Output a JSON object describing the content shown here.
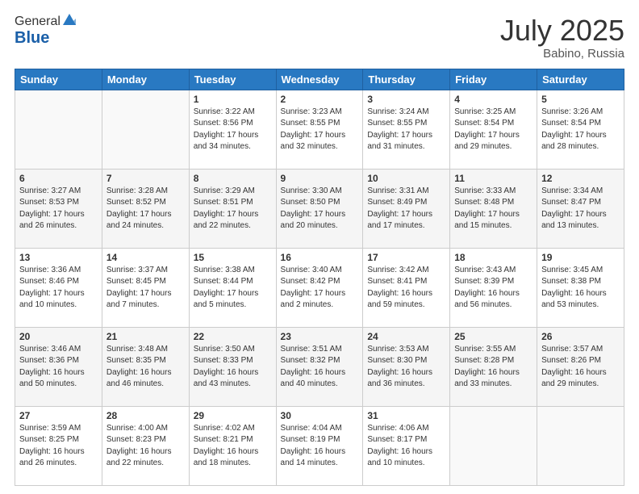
{
  "header": {
    "logo_general": "General",
    "logo_blue": "Blue",
    "month_year": "July 2025",
    "location": "Babino, Russia"
  },
  "calendar": {
    "days_of_week": [
      "Sunday",
      "Monday",
      "Tuesday",
      "Wednesday",
      "Thursday",
      "Friday",
      "Saturday"
    ],
    "weeks": [
      [
        {
          "day": "",
          "info": ""
        },
        {
          "day": "",
          "info": ""
        },
        {
          "day": "1",
          "sunrise": "3:22 AM",
          "sunset": "8:56 PM",
          "daylight": "17 hours and 34 minutes."
        },
        {
          "day": "2",
          "sunrise": "3:23 AM",
          "sunset": "8:55 PM",
          "daylight": "17 hours and 32 minutes."
        },
        {
          "day": "3",
          "sunrise": "3:24 AM",
          "sunset": "8:55 PM",
          "daylight": "17 hours and 31 minutes."
        },
        {
          "day": "4",
          "sunrise": "3:25 AM",
          "sunset": "8:54 PM",
          "daylight": "17 hours and 29 minutes."
        },
        {
          "day": "5",
          "sunrise": "3:26 AM",
          "sunset": "8:54 PM",
          "daylight": "17 hours and 28 minutes."
        }
      ],
      [
        {
          "day": "6",
          "sunrise": "3:27 AM",
          "sunset": "8:53 PM",
          "daylight": "17 hours and 26 minutes."
        },
        {
          "day": "7",
          "sunrise": "3:28 AM",
          "sunset": "8:52 PM",
          "daylight": "17 hours and 24 minutes."
        },
        {
          "day": "8",
          "sunrise": "3:29 AM",
          "sunset": "8:51 PM",
          "daylight": "17 hours and 22 minutes."
        },
        {
          "day": "9",
          "sunrise": "3:30 AM",
          "sunset": "8:50 PM",
          "daylight": "17 hours and 20 minutes."
        },
        {
          "day": "10",
          "sunrise": "3:31 AM",
          "sunset": "8:49 PM",
          "daylight": "17 hours and 17 minutes."
        },
        {
          "day": "11",
          "sunrise": "3:33 AM",
          "sunset": "8:48 PM",
          "daylight": "17 hours and 15 minutes."
        },
        {
          "day": "12",
          "sunrise": "3:34 AM",
          "sunset": "8:47 PM",
          "daylight": "17 hours and 13 minutes."
        }
      ],
      [
        {
          "day": "13",
          "sunrise": "3:36 AM",
          "sunset": "8:46 PM",
          "daylight": "17 hours and 10 minutes."
        },
        {
          "day": "14",
          "sunrise": "3:37 AM",
          "sunset": "8:45 PM",
          "daylight": "17 hours and 7 minutes."
        },
        {
          "day": "15",
          "sunrise": "3:38 AM",
          "sunset": "8:44 PM",
          "daylight": "17 hours and 5 minutes."
        },
        {
          "day": "16",
          "sunrise": "3:40 AM",
          "sunset": "8:42 PM",
          "daylight": "17 hours and 2 minutes."
        },
        {
          "day": "17",
          "sunrise": "3:42 AM",
          "sunset": "8:41 PM",
          "daylight": "16 hours and 59 minutes."
        },
        {
          "day": "18",
          "sunrise": "3:43 AM",
          "sunset": "8:39 PM",
          "daylight": "16 hours and 56 minutes."
        },
        {
          "day": "19",
          "sunrise": "3:45 AM",
          "sunset": "8:38 PM",
          "daylight": "16 hours and 53 minutes."
        }
      ],
      [
        {
          "day": "20",
          "sunrise": "3:46 AM",
          "sunset": "8:36 PM",
          "daylight": "16 hours and 50 minutes."
        },
        {
          "day": "21",
          "sunrise": "3:48 AM",
          "sunset": "8:35 PM",
          "daylight": "16 hours and 46 minutes."
        },
        {
          "day": "22",
          "sunrise": "3:50 AM",
          "sunset": "8:33 PM",
          "daylight": "16 hours and 43 minutes."
        },
        {
          "day": "23",
          "sunrise": "3:51 AM",
          "sunset": "8:32 PM",
          "daylight": "16 hours and 40 minutes."
        },
        {
          "day": "24",
          "sunrise": "3:53 AM",
          "sunset": "8:30 PM",
          "daylight": "16 hours and 36 minutes."
        },
        {
          "day": "25",
          "sunrise": "3:55 AM",
          "sunset": "8:28 PM",
          "daylight": "16 hours and 33 minutes."
        },
        {
          "day": "26",
          "sunrise": "3:57 AM",
          "sunset": "8:26 PM",
          "daylight": "16 hours and 29 minutes."
        }
      ],
      [
        {
          "day": "27",
          "sunrise": "3:59 AM",
          "sunset": "8:25 PM",
          "daylight": "16 hours and 26 minutes."
        },
        {
          "day": "28",
          "sunrise": "4:00 AM",
          "sunset": "8:23 PM",
          "daylight": "16 hours and 22 minutes."
        },
        {
          "day": "29",
          "sunrise": "4:02 AM",
          "sunset": "8:21 PM",
          "daylight": "16 hours and 18 minutes."
        },
        {
          "day": "30",
          "sunrise": "4:04 AM",
          "sunset": "8:19 PM",
          "daylight": "16 hours and 14 minutes."
        },
        {
          "day": "31",
          "sunrise": "4:06 AM",
          "sunset": "8:17 PM",
          "daylight": "16 hours and 10 minutes."
        },
        {
          "day": "",
          "info": ""
        },
        {
          "day": "",
          "info": ""
        }
      ]
    ]
  }
}
